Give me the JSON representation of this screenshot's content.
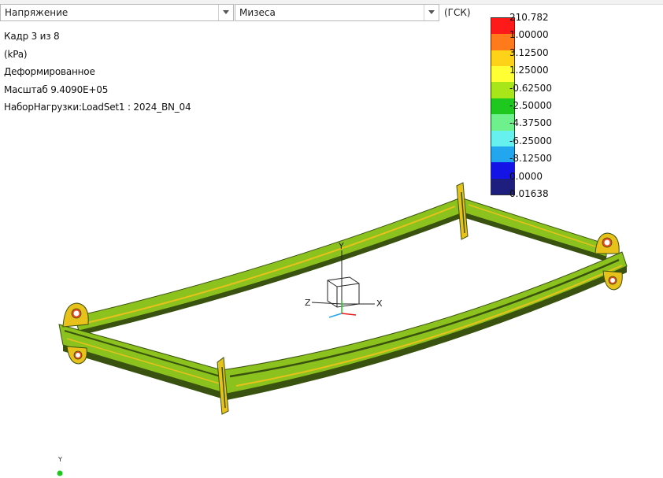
{
  "toolbar": {
    "result_quantity": "Напряжение",
    "component": "Мизеса",
    "csys": "(ГСК)"
  },
  "info": {
    "frame": "Кадр 3 из 8",
    "units": "(kPa)",
    "state": "Деформированное",
    "scale": "Масштаб  9.4090E+05",
    "loadset": "НаборНагрузки:LoadSet1 :  2024_BN_04"
  },
  "legend": {
    "labels": [
      "210.782",
      "1.00000",
      "3.12500",
      "1.25000",
      "-0.62500",
      "-2.50000",
      "-4.37500",
      "-6.25000",
      "-8.12500",
      "0.0000",
      "0.01638"
    ],
    "colors": [
      "#ff1a1a",
      "#ff7a1a",
      "#ffd21a",
      "#ffff33",
      "#a8e61a",
      "#1ec81e",
      "#6ef08c",
      "#66f0ee",
      "#22a6ee",
      "#1414e6",
      "#1e1e7e"
    ]
  },
  "model": {
    "main_color": "#8cc21e",
    "dark_color": "#3a5210",
    "stress_color": "#e8c21a",
    "hot_color": "#e84a1a"
  },
  "triad": {
    "x_label": "X",
    "y_label": "Y",
    "z_label": "Z",
    "mini_label": "Y"
  }
}
